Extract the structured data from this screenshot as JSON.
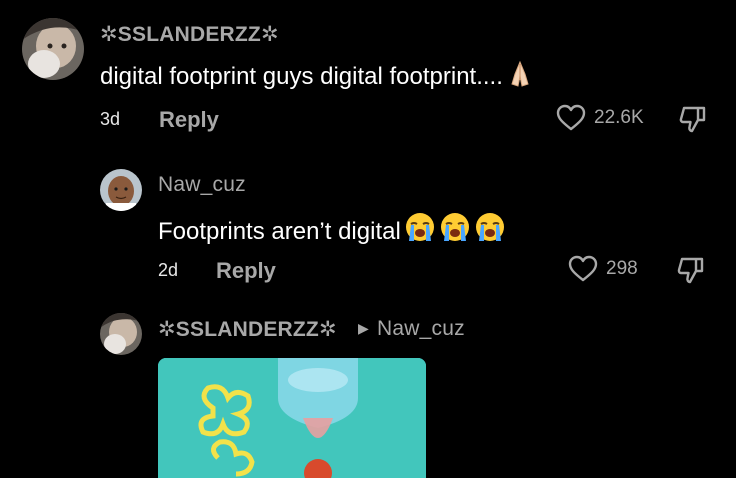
{
  "comments": [
    {
      "username": "✲SSLANDERZZ✲",
      "text": "digital footprint guys digital footprint....",
      "emoji": "pray-emoji",
      "time": "3d",
      "reply_label": "Reply",
      "likes": "22.6K"
    },
    {
      "username": "Naw_cuz",
      "text": "Footprints aren’t digital",
      "emoji": "crying-emoji x3",
      "time": "2d",
      "reply_label": "Reply",
      "likes": "298"
    },
    {
      "username": "✲SSLANDERZZ✲",
      "reply_to": "Naw_cuz",
      "attachment": "gif-image"
    }
  ],
  "colors": {
    "background": "#000000",
    "secondary_text": "#a8a8a8",
    "primary_text": "#ffffff"
  }
}
